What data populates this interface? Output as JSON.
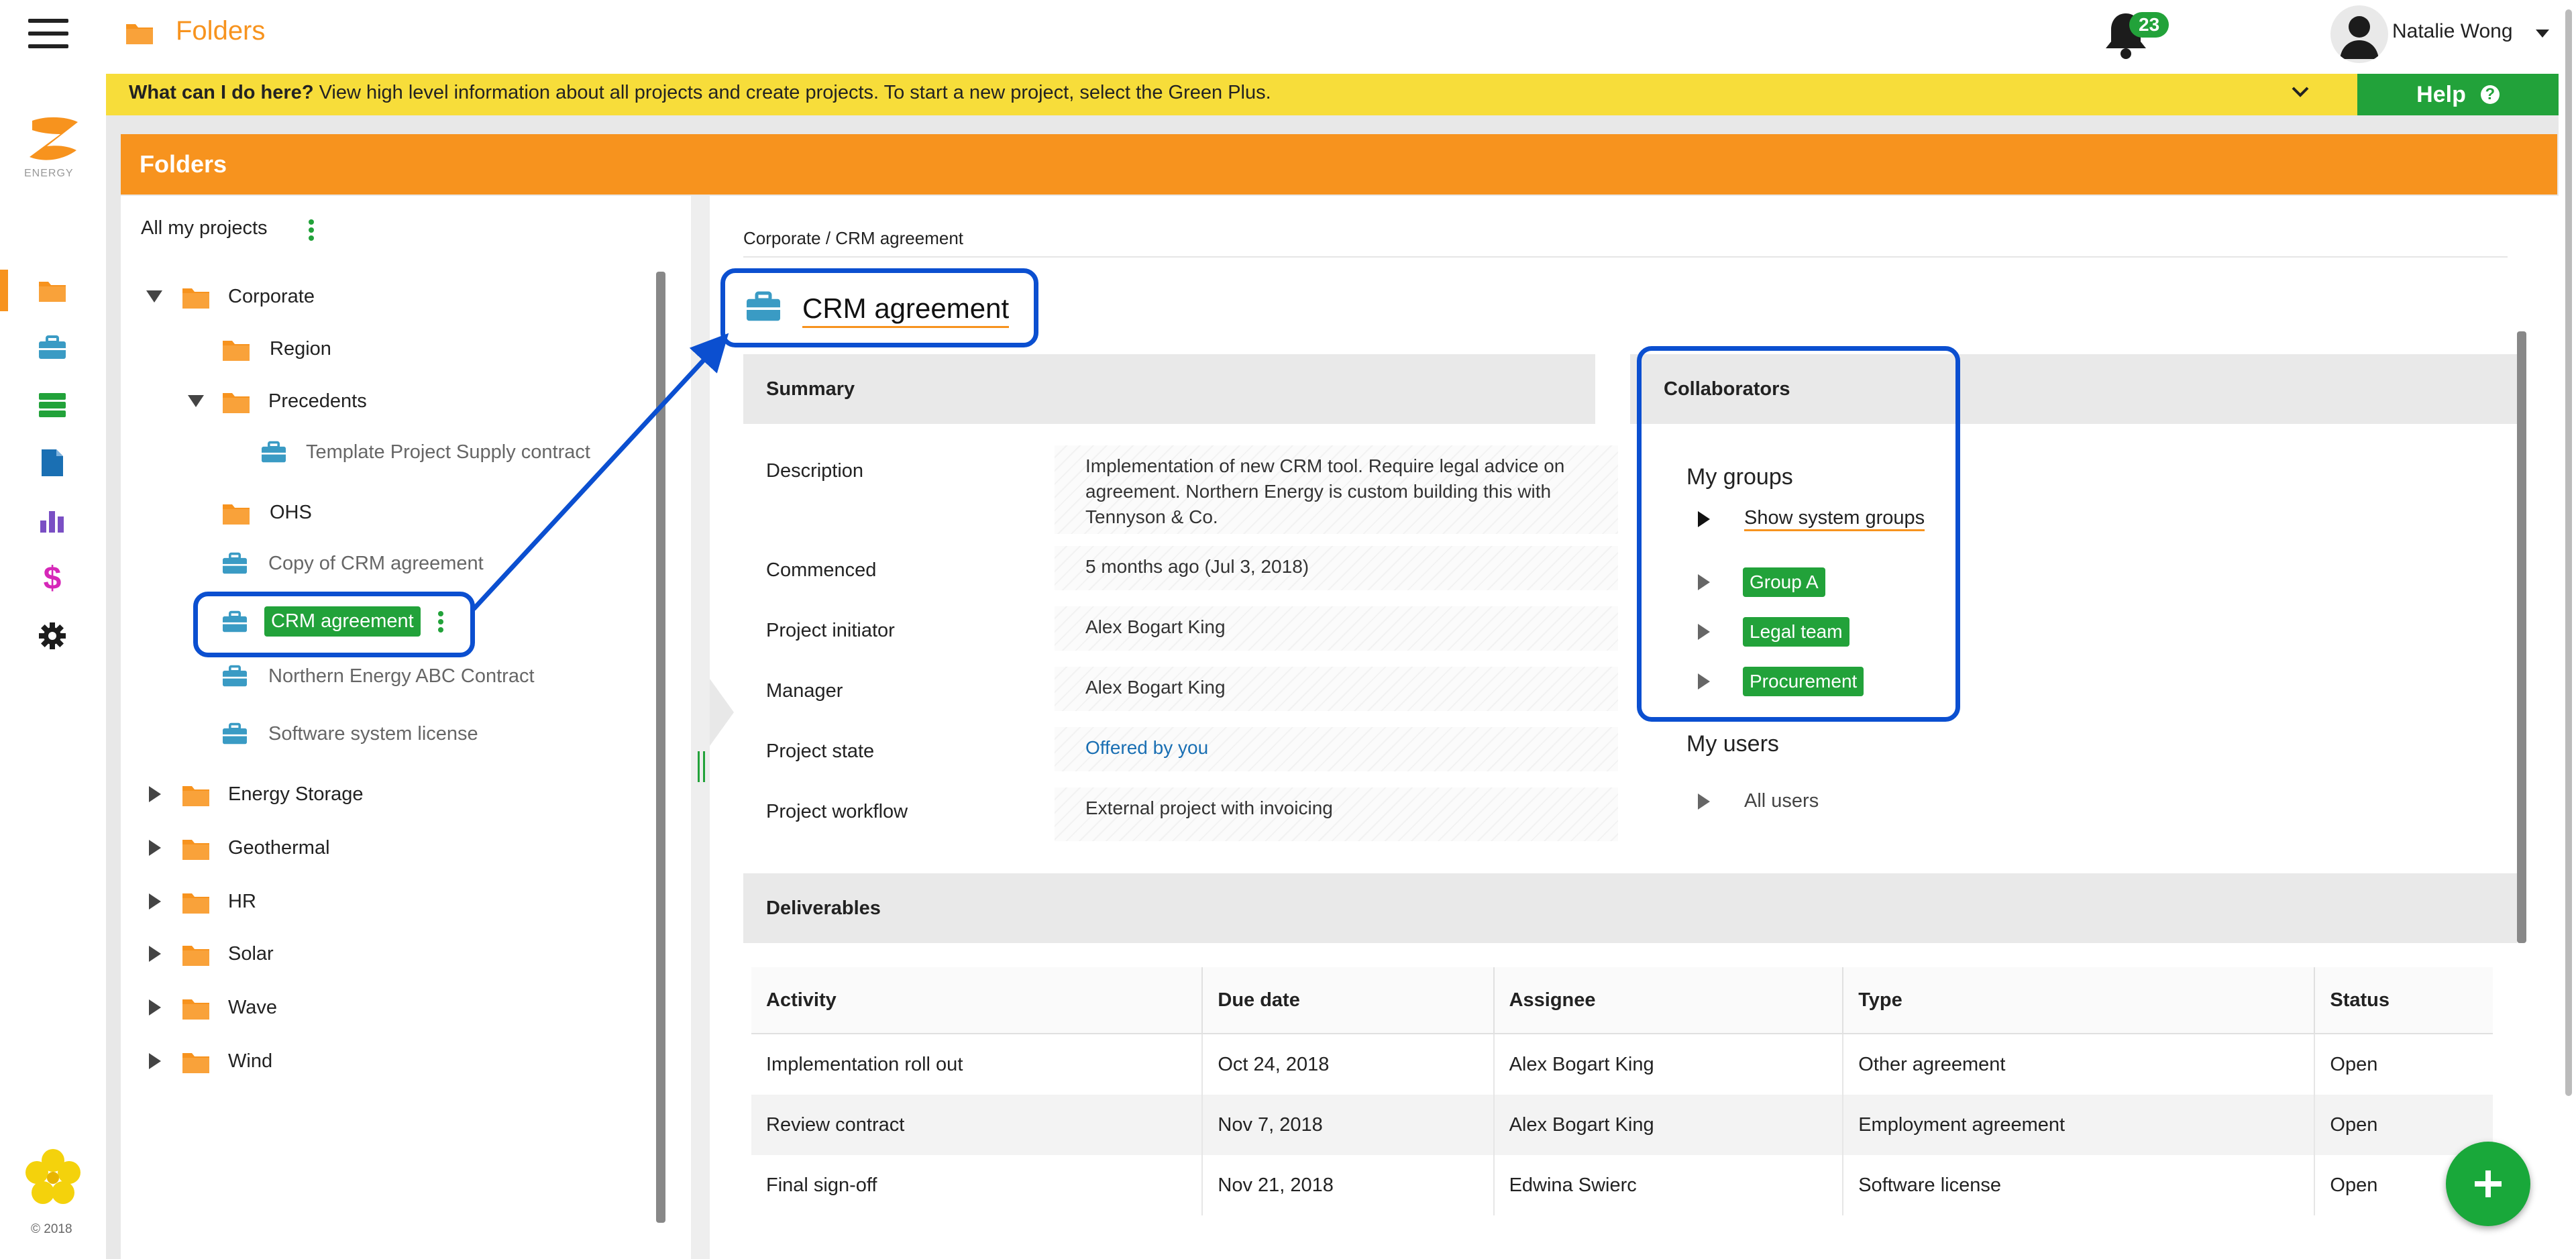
{
  "header": {
    "page_title": "Folders",
    "notification_count": "23",
    "user_name": "Natalie Wong"
  },
  "help": {
    "lead": "What can I do here?",
    "text": " View high level information about all projects and create projects. To start a new project, select the Green Plus.",
    "button_label": "Help",
    "button_icon": "?"
  },
  "rail": {
    "logo_text": "ENERGY",
    "copyright": "© 2018",
    "icons": [
      "folder-icon",
      "briefcase-icon",
      "database-icon",
      "document-icon",
      "bar-chart-icon",
      "dollar-icon",
      "gear-icon"
    ]
  },
  "panel": {
    "title": "Folders"
  },
  "tree": {
    "root_label": "All my projects",
    "nodes": [
      {
        "label": "Corporate"
      },
      {
        "label": "Region"
      },
      {
        "label": "Precedents"
      },
      {
        "label": "Template Project Supply contract"
      },
      {
        "label": "OHS"
      },
      {
        "label": "Copy of CRM agreement"
      },
      {
        "label": "CRM agreement"
      },
      {
        "label": "Northern Energy ABC Contract"
      },
      {
        "label": "Software system license"
      },
      {
        "label": "Energy Storage"
      },
      {
        "label": "Geothermal"
      },
      {
        "label": "HR"
      },
      {
        "label": "Solar"
      },
      {
        "label": "Wave"
      },
      {
        "label": "Wind"
      }
    ]
  },
  "project": {
    "breadcrumb": "Corporate / CRM agreement",
    "title": "CRM agreement",
    "summary_heading": "Summary",
    "fields": [
      {
        "label": "Description",
        "value": "Implementation of new CRM tool. Require legal advice on agreement. Northern Energy is custom building this with Tennyson & Co."
      },
      {
        "label": "Commenced",
        "value": "5 months ago (Jul 3, 2018)"
      },
      {
        "label": "Project initiator",
        "value": "Alex Bogart King"
      },
      {
        "label": "Manager",
        "value": "Alex Bogart King"
      },
      {
        "label": "Project state",
        "value": "Offered by you"
      },
      {
        "label": "Project workflow",
        "value": "External project with invoicing"
      }
    ]
  },
  "collaborators": {
    "heading": "Collaborators",
    "my_groups": "My groups",
    "show_system": "Show system groups",
    "groups": [
      "Group A",
      "Legal team",
      "Procurement"
    ],
    "my_users": "My users",
    "all_users": "All users"
  },
  "deliverables": {
    "heading": "Deliverables",
    "columns": [
      "Activity",
      "Due date",
      "Assignee",
      "Type",
      "Status"
    ],
    "rows": [
      [
        "Implementation roll out",
        "Oct 24, 2018",
        "Alex Bogart King",
        "Other agreement",
        "Open"
      ],
      [
        "Review contract",
        "Nov 7, 2018",
        "Alex Bogart King",
        "Employment agreement",
        "Open"
      ],
      [
        "Final sign-off",
        "Nov 21, 2018",
        "Edwina Swierc",
        "Software license",
        "Open"
      ]
    ]
  },
  "colors": {
    "accent_orange": "#f7931e",
    "green": "#22a23a",
    "help_yellow": "#f7dd3a",
    "highlight_blue": "#0b4fd0"
  }
}
